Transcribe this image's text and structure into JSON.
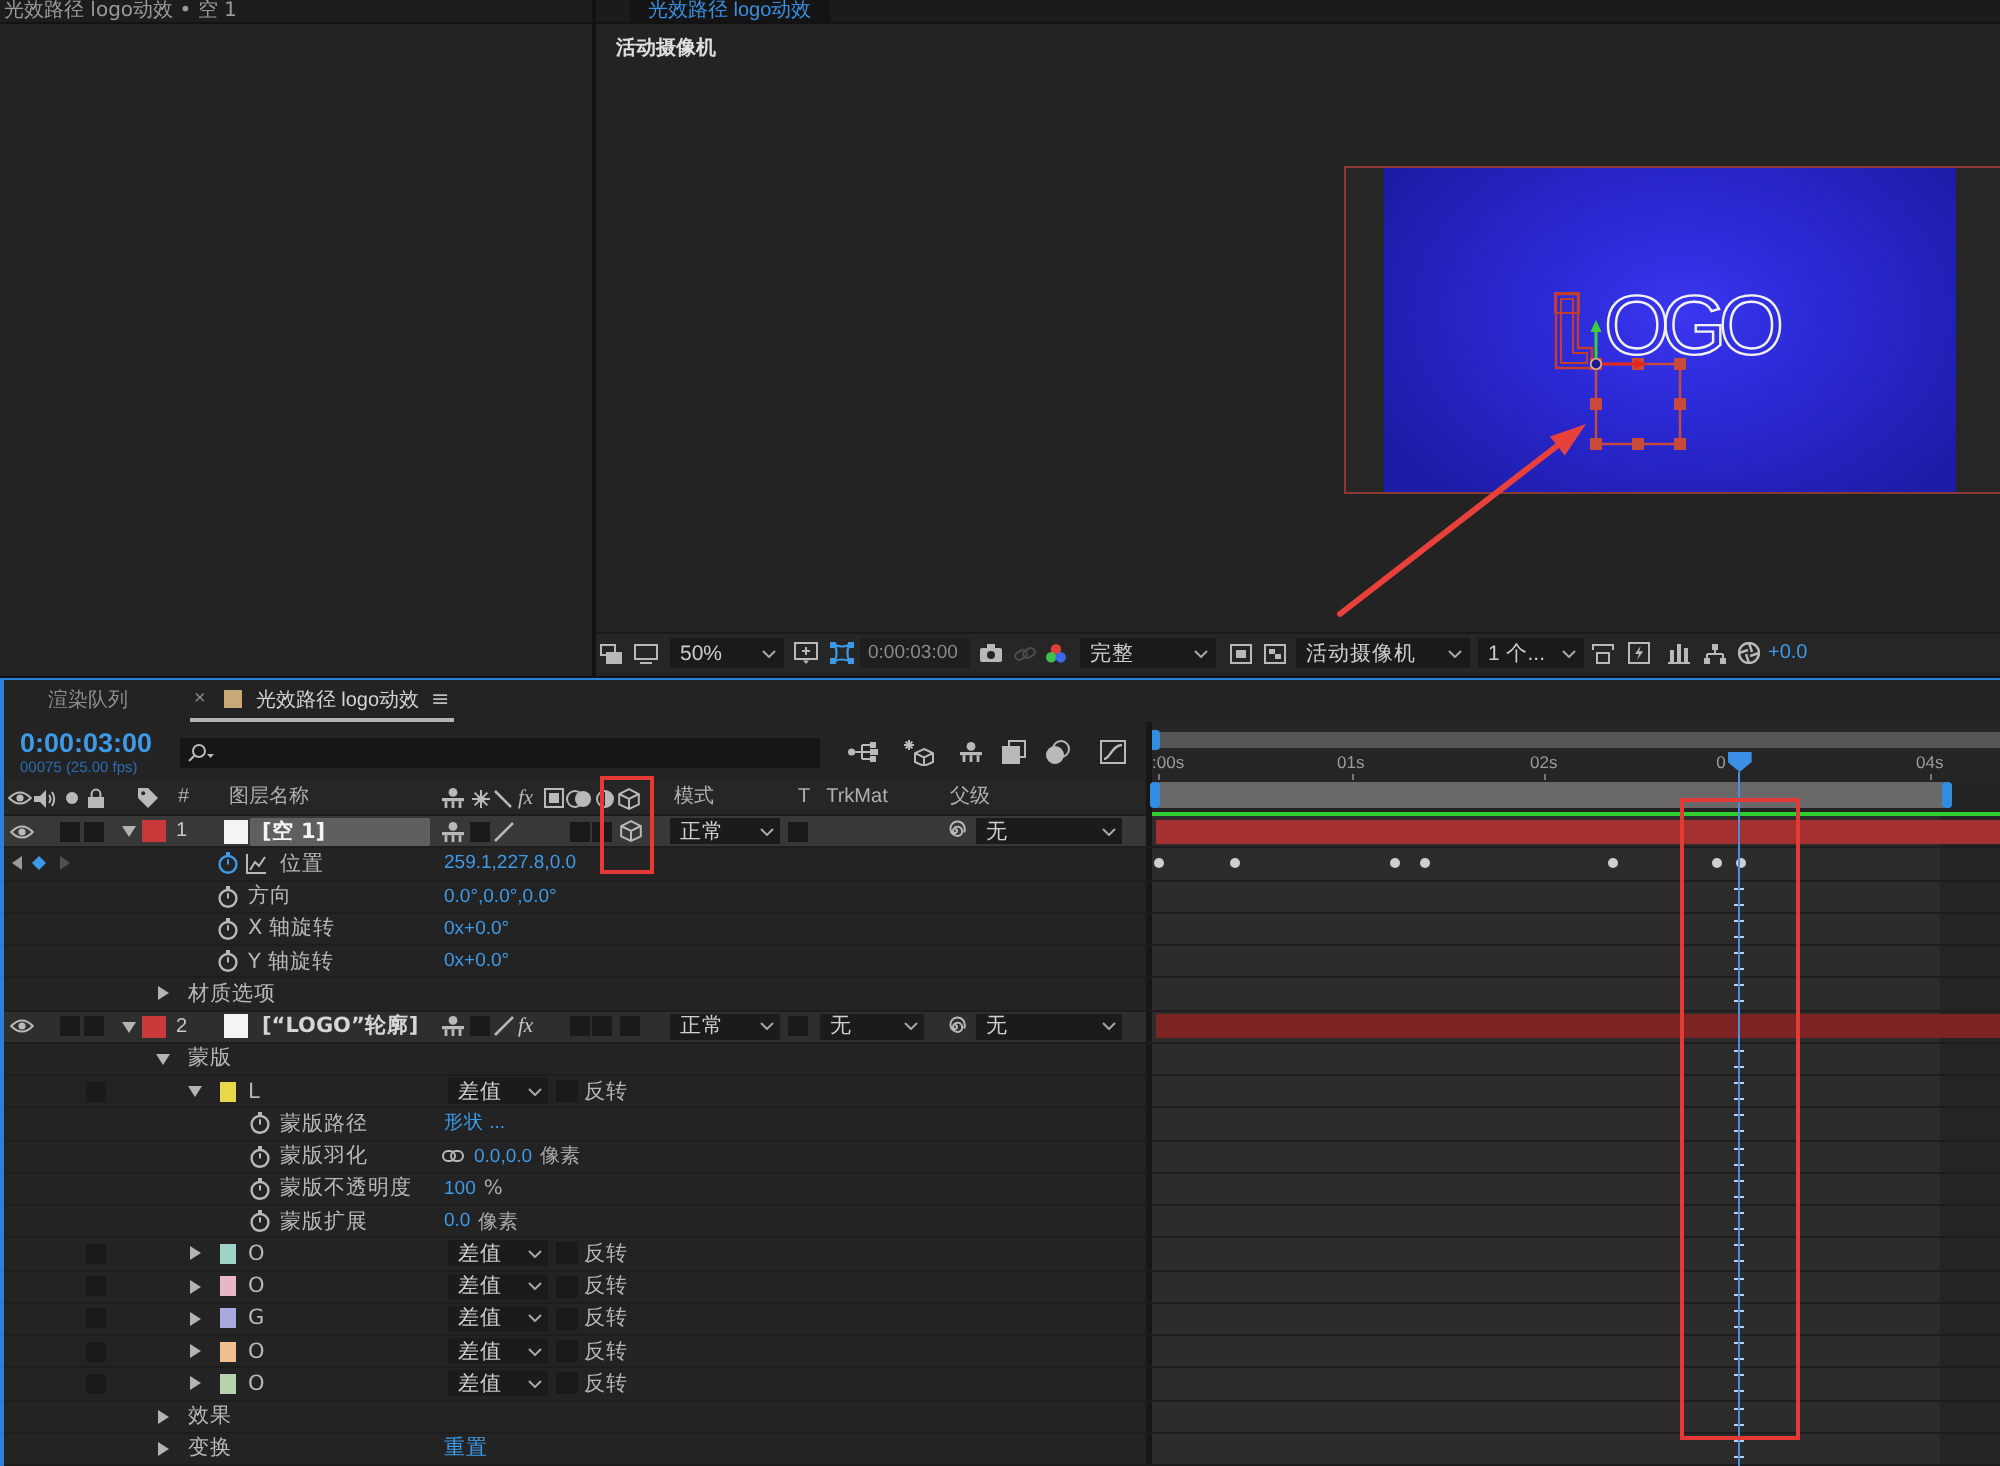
{
  "project_panel": {
    "tab_title": "光效路径 logo动效 • 空 1"
  },
  "viewer": {
    "tab_title": "光效路径 logo动效",
    "camera_label": "活动摄像机",
    "logo_text": "OGO",
    "toolbar": {
      "zoom": "50%",
      "timecode": "0:00:03:00",
      "resolution": "完整",
      "camera": "活动摄像机",
      "views": "1 个...",
      "exposure": "+0.0"
    }
  },
  "timeline": {
    "tabs": [
      {
        "label": "渲染队列",
        "selected": false
      },
      {
        "label": "光效路径 logo动效",
        "selected": true,
        "color": "#c9a878",
        "close": "×",
        "menu": "≡"
      }
    ],
    "timecode": "0:00:03:00",
    "frame_info": "00075 (25.00 fps)",
    "columns": {
      "number": "#",
      "name": "图层名称",
      "fx": "fx",
      "mode": "模式",
      "t": "T",
      "trkmat": "TrkMat",
      "parent": "父级"
    },
    "ruler": [
      ":00s",
      "01s",
      "02s",
      "0",
      "04s"
    ],
    "playhead": {
      "level": 0.693
    },
    "layers": [
      {
        "number": "1",
        "name": "[空 1]",
        "color": "#c83a3a",
        "selected": true,
        "expanded": true,
        "visible": true,
        "three_d": true,
        "mode": "正常",
        "parent": "无",
        "children": [
          {
            "kind": "property",
            "name": "位置",
            "value": "259.1,227.8,0.0",
            "animated": true
          },
          {
            "kind": "property",
            "name": "方向",
            "value": "0.0°,0.0°,0.0°",
            "animated": false
          },
          {
            "kind": "property",
            "name": "X 轴旋转",
            "value": "0x+0.0°",
            "animated": false
          },
          {
            "kind": "property",
            "name": "Y 轴旋转",
            "value": "0x+0.0°",
            "animated": false
          },
          {
            "kind": "group",
            "name": "材质选项",
            "expanded": false
          }
        ]
      },
      {
        "number": "2",
        "name": "[“LOGO”轮廓]",
        "color": "#c83a3a",
        "selected": false,
        "expanded": true,
        "visible": true,
        "three_d": false,
        "effects": {
          "label": "fx",
          "on": true
        },
        "mode": "正常",
        "trkmat": "无",
        "parent": "无",
        "children": [
          {
            "kind": "group",
            "name": "蒙版",
            "expanded": true,
            "children": [
              {
                "kind": "mask",
                "name": "L",
                "color": "#e6d84a",
                "expanded": true,
                "mode": "差值",
                "inverted": false,
                "invert_label": "反转",
                "children": [
                  {
                    "kind": "property",
                    "name": "蒙版路径",
                    "value": "形状 ...",
                    "animated": false
                  },
                  {
                    "kind": "property",
                    "name": "蒙版羽化",
                    "value": "0.0,0.0",
                    "unit": "像素",
                    "animated": false,
                    "linked": true
                  },
                  {
                    "kind": "property",
                    "name": "蒙版不透明度",
                    "value": "100",
                    "unit": "%",
                    "animated": false
                  },
                  {
                    "kind": "property",
                    "name": "蒙版扩展",
                    "value": "0.0",
                    "unit": "像素",
                    "animated": false
                  }
                ]
              },
              {
                "kind": "mask",
                "name": "O",
                "color": "#9fd3c7",
                "expanded": false,
                "mode": "差值",
                "inverted": false,
                "invert_label": "反转"
              },
              {
                "kind": "mask",
                "name": "O",
                "color": "#e7b6c9",
                "expanded": false,
                "mode": "差值",
                "inverted": false,
                "invert_label": "反转"
              },
              {
                "kind": "mask",
                "name": "G",
                "color": "#a9a9df",
                "expanded": false,
                "mode": "差值",
                "inverted": false,
                "invert_label": "反转"
              },
              {
                "kind": "mask",
                "name": "O",
                "color": "#f0c08e",
                "expanded": false,
                "mode": "差值",
                "inverted": false,
                "invert_label": "反转"
              },
              {
                "kind": "mask",
                "name": "O",
                "color": "#b5d3ad",
                "expanded": false,
                "mode": "差值",
                "inverted": false,
                "invert_label": "反转"
              }
            ]
          },
          {
            "kind": "group",
            "name": "效果",
            "expanded": false
          },
          {
            "kind": "group",
            "name": "变换",
            "expanded": false,
            "value": "重置"
          }
        ]
      }
    ]
  }
}
